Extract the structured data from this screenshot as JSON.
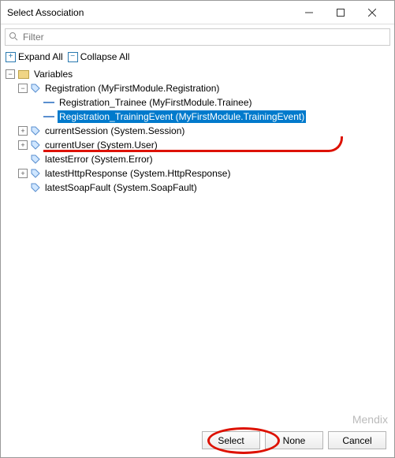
{
  "window": {
    "title": "Select Association"
  },
  "search": {
    "placeholder": "Filter"
  },
  "toolbar": {
    "expand": "Expand All",
    "collapse": "Collapse All"
  },
  "tree": {
    "root": "Variables",
    "registration": "Registration (MyFirstModule.Registration)",
    "reg_trainee": "Registration_Trainee (MyFirstModule.Trainee)",
    "reg_training_event": "Registration_TrainingEvent (MyFirstModule.TrainingEvent)",
    "current_session": "currentSession (System.Session)",
    "current_user": "currentUser (System.User)",
    "latest_error": "latestError (System.Error)",
    "latest_http": "latestHttpResponse (System.HttpResponse)",
    "latest_soap": "latestSoapFault (System.SoapFault)"
  },
  "buttons": {
    "select": "Select",
    "none": "None",
    "cancel": "Cancel"
  },
  "watermark": "Mendix",
  "colors": {
    "selection": "#007acc",
    "annotation": "#d10"
  }
}
